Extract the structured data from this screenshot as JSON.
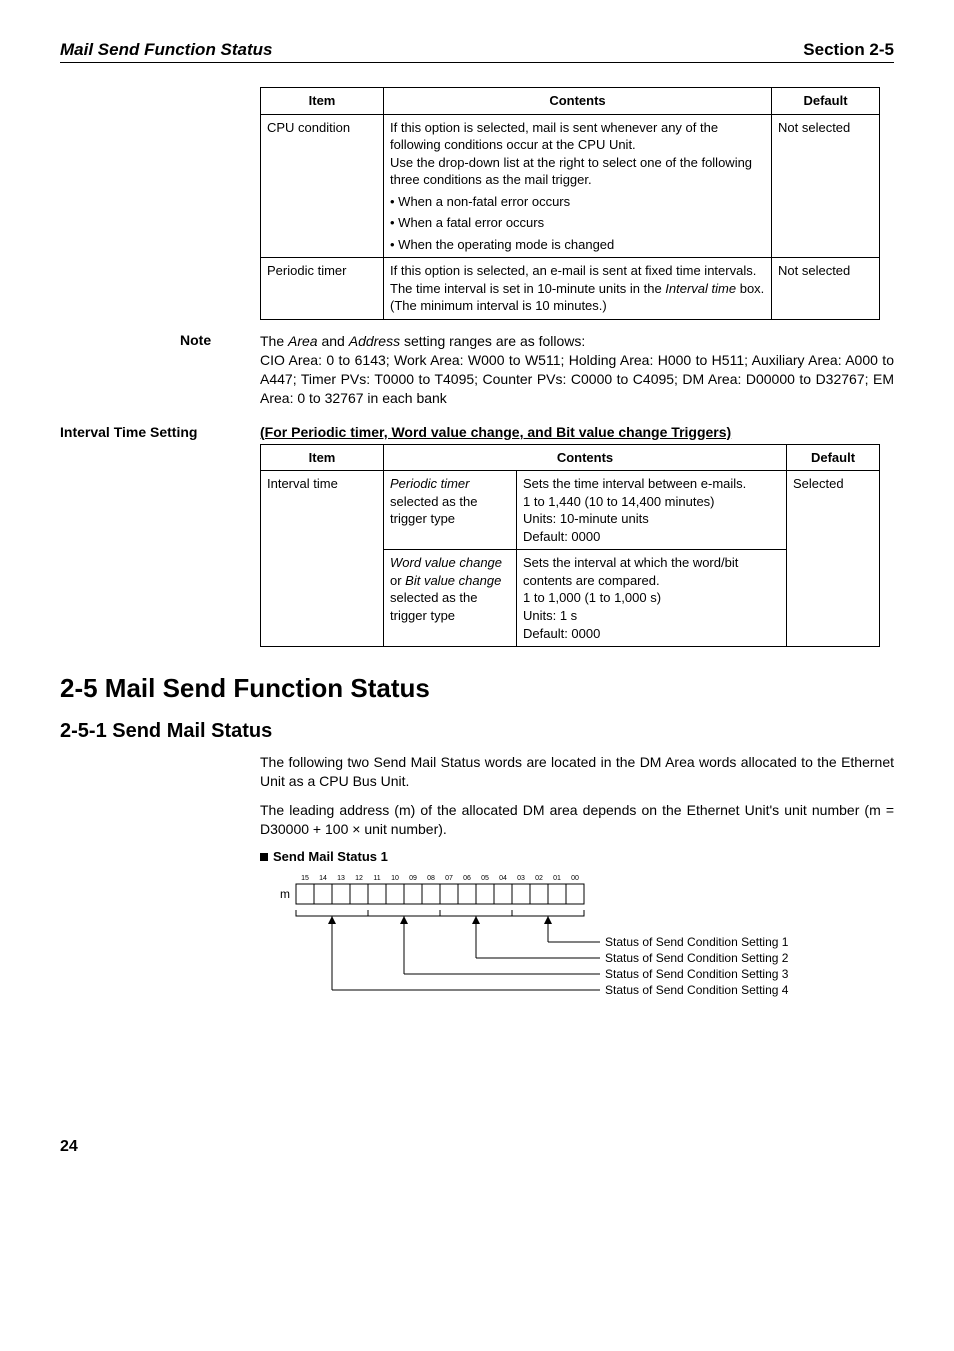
{
  "header": {
    "left": "Mail Send Function Status",
    "right": "Section 2-5"
  },
  "table1": {
    "headers": [
      "Item",
      "Contents",
      "Default"
    ],
    "rows": [
      {
        "item": "CPU condition",
        "contents_top": "If this option is selected, mail is sent whenever any of the following conditions occur at the CPU Unit.\nUse the drop-down list at the right to select one of the following three conditions as the mail trigger.",
        "bullets": [
          "When a non-fatal error occurs",
          "When a fatal error occurs",
          "When the operating mode is changed"
        ],
        "default": "Not selected"
      },
      {
        "item": "Periodic timer",
        "contents": "If this option is selected, an e-mail is sent at fixed time intervals. The time interval is set in 10-minute units in the Interval time box. (The minimum interval is 10 minutes.)",
        "default": "Not selected"
      }
    ]
  },
  "note": {
    "label": "Note",
    "para": "The Area and Address setting ranges are as follows:\nCIO Area: 0 to 6143; Work Area: W000 to W511; Holding Area: H000 to H511; Auxiliary Area: A000 to A447; Timer PVs: T0000 to T4095; Counter PVs: C0000 to C4095; DM Area: D00000 to D32767; EM Area: 0 to 32767 in each bank"
  },
  "interval": {
    "side_label": "Interval Time Setting",
    "title": "(For Periodic timer, Word value change, and Bit value change Triggers)",
    "headers": [
      "Item",
      "Contents",
      "Default"
    ],
    "row_item": "Interval time",
    "row_default": "Selected",
    "cells": [
      {
        "left_em": "Periodic timer",
        "left_rest": " selected as the trigger type",
        "right": "Sets the time interval between e-mails.\n1 to 1,440 (10 to 14,400 minutes)\nUnits: 10-minute units\nDefault: 0000"
      },
      {
        "left_em": "Word value change",
        "left_mid": " or ",
        "left_em2": "Bit value change",
        "left_rest": " selected as the trigger type",
        "right": "Sets the interval at which the word/bit contents are compared.\n1 to 1,000 (1 to 1,000 s)\nUnits: 1 s\nDefault: 0000"
      }
    ]
  },
  "sec25": "2-5    Mail Send Function Status",
  "sec251": "2-5-1    Send Mail Status",
  "para1": "The following two Send Mail Status words are located in the DM Area words allocated to the Ethernet Unit as a CPU Bus Unit.",
  "para2_a": "The leading address (m) of the allocated DM area depends on the Ethernet Unit's unit number (m = D30000 + 100 ",
  "para2_b": " unit number).",
  "sms_head": "Send Mail Status 1",
  "diagram": {
    "m_label": "m",
    "bits": [
      "15",
      "14",
      "13",
      "12",
      "11",
      "10",
      "09",
      "08",
      "07",
      "06",
      "05",
      "04",
      "03",
      "02",
      "01",
      "00"
    ],
    "labels": [
      "Status of Send Condition Setting 1",
      "Status of Send Condition Setting 2",
      "Status of Send Condition Setting 3",
      "Status of Send Condition Setting 4"
    ]
  },
  "page": "24"
}
